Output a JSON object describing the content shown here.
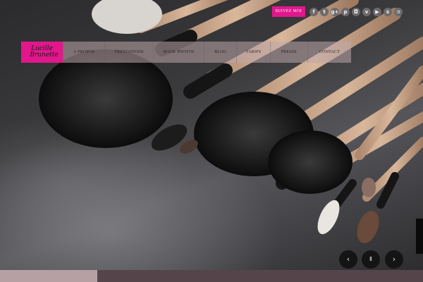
{
  "topbar": {
    "cta_label": "SUIVEZ MOI",
    "social_icons": [
      {
        "name": "facebook",
        "glyph": "f"
      },
      {
        "name": "twitter",
        "glyph": "t"
      },
      {
        "name": "google-plus",
        "glyph": "g+"
      },
      {
        "name": "pinterest",
        "glyph": "p"
      },
      {
        "name": "instagram",
        "glyph": "◘"
      },
      {
        "name": "vimeo",
        "glyph": "v"
      },
      {
        "name": "youtube",
        "glyph": "▶"
      },
      {
        "name": "skype",
        "glyph": "s"
      },
      {
        "name": "rss",
        "glyph": "⊃"
      }
    ]
  },
  "logo": {
    "line1": "Lucille",
    "line2": "Brunette"
  },
  "nav": {
    "items": [
      "A PROPOS",
      "PRESTATIONS",
      "BOOK PHOTOS",
      "BLOG",
      "TARIFS",
      "PRESSE",
      "CONTACT"
    ]
  },
  "slider": {
    "prev_glyph": "‹",
    "pause_glyph": "Ⅱ",
    "next_glyph": "›"
  },
  "colors": {
    "accent": "#e2178c",
    "nav_bg": "#bea8ac",
    "bottom_bar": "#55454a",
    "bottom_bar_segment": "#b6a0a4"
  }
}
